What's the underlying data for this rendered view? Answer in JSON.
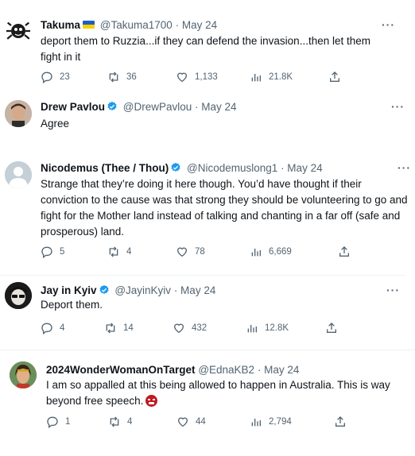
{
  "tweets": [
    {
      "name": "Takuma",
      "handle": "@Takuma1700",
      "date": "· May 24",
      "text": "deport them to Ruzzia...if they can defend the invasion...then let them fight in it",
      "replies": "23",
      "retweets": "36",
      "likes": "1,133",
      "views": "21.8K"
    },
    {
      "name": "Drew Pavlou",
      "handle": "@DrewPavlou",
      "date": "· May 24",
      "text": "Agree"
    },
    {
      "name": "Nicodemus (Thee / Thou)",
      "handle": "@Nicodemuslong1",
      "date": "· May 24",
      "text": "Strange that they’re doing it here though. You’d have thought if their conviction to the cause was that strong they should be volunteering to go and fight for the Mother land instead of talking and chanting in a far off (safe and prosperous) land.",
      "replies": "5",
      "retweets": "4",
      "likes": "78",
      "views": "6,669"
    },
    {
      "name": "Jay in Kyiv",
      "handle": "@JayinKyiv",
      "date": "· May 24",
      "text": "Deport them.",
      "replies": "4",
      "retweets": "14",
      "likes": "432",
      "views": "12.8K"
    },
    {
      "name": "2024WonderWomanOnTarget",
      "handle": "@EdnaKB2",
      "date": "· May 24",
      "text": "I am so appalled at this being allowed to happen in Australia. This is way beyond free speech.",
      "replies": "1",
      "retweets": "4",
      "likes": "44",
      "views": "2,794"
    }
  ],
  "more_label": "···",
  "colors": {
    "verified": "#1d9bf0",
    "muted": "#536471",
    "text": "#0f1419"
  }
}
